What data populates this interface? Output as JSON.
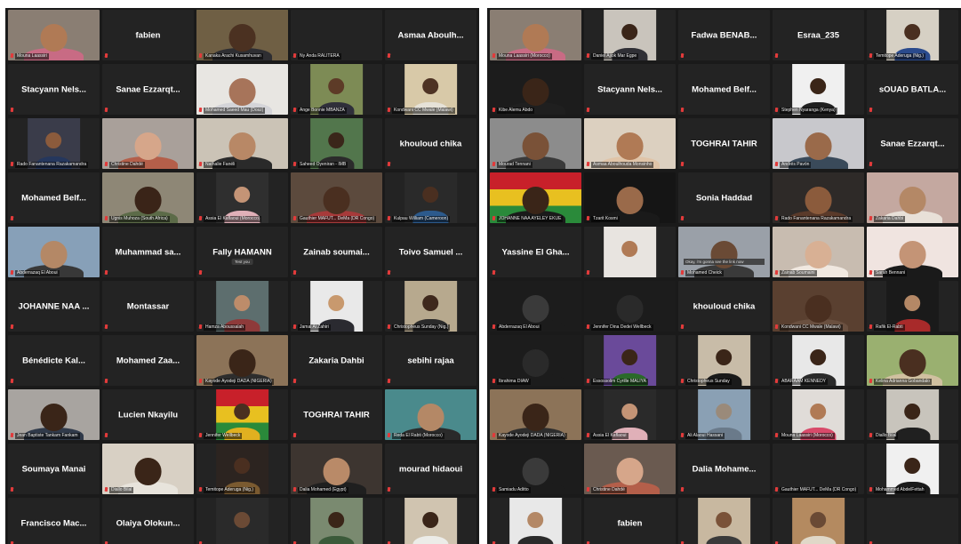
{
  "left_tiles": [
    {
      "kind": "video",
      "label": "Mouna Laassiri",
      "bg": "#8a7e73",
      "skin": "#b07a55",
      "shirt": "#c86b84",
      "wide": true
    },
    {
      "kind": "name",
      "label": "fabien"
    },
    {
      "kind": "video",
      "label": "Kanaka Arachi Kusamhuvan",
      "bg": "#6f5f44",
      "skin": "#4b3121",
      "shirt": "#2e2e32",
      "wide": true,
      "active": true
    },
    {
      "kind": "name",
      "label": "",
      "sub": "Ny Anda RALITERA"
    },
    {
      "kind": "name",
      "label": "Asmaa Aboulh..."
    },
    {
      "kind": "name",
      "label": "Stacyann Nels..."
    },
    {
      "kind": "name",
      "label": "Sanae Ezzarqt..."
    },
    {
      "kind": "video",
      "label": "Mohamed Saeed Mau (Dosz)",
      "bg": "#e8e6e2",
      "skin": "#a7745a",
      "shirt": "#d4d4d8",
      "wide": true
    },
    {
      "kind": "video",
      "label": "Ange Bonnie MBANZA",
      "bg": "#7d8b55",
      "skin": "#5d3b27",
      "shirt": "#2f2f3a",
      "wide": false
    },
    {
      "kind": "video",
      "label": "Kondwani CC Mwale (Malawi)",
      "bg": "#d8c9a8",
      "skin": "#4e3324",
      "shirt": "#e6e2d8",
      "wide": false
    },
    {
      "kind": "video",
      "label": "Rado Fanantenana Razakamandra",
      "bg": "#3a3c4a",
      "skin": "#8b5b3c",
      "shirt": "#25375d",
      "wide": false
    },
    {
      "kind": "video",
      "label": "Christine Dahdé",
      "bg": "#a9a09a",
      "skin": "#d6a68a",
      "shirt": "#b45f4a",
      "wide": true
    },
    {
      "kind": "video",
      "label": "Nathalie Fanéli",
      "bg": "#cbc3b6",
      "skin": "#b88866",
      "shirt": "#2a2a2a",
      "wide": true
    },
    {
      "kind": "video",
      "label": "Saheed Oyeniran - IMB",
      "bg": "#52764c",
      "skin": "#3a261a",
      "shirt": "#2b2b2b",
      "wide": false
    },
    {
      "kind": "name",
      "label": "khouloud chika"
    },
    {
      "kind": "name",
      "label": "Mohamed Belf..."
    },
    {
      "kind": "video",
      "label": "Ugnis Muhoza (South Africa)",
      "bg": "#8e8776",
      "skin": "#3a2418",
      "shirt": "#5c6b48",
      "wide": true
    },
    {
      "kind": "video",
      "label": "Assia El Kaflaoui (Morocco)",
      "bg": "#2f2f2f",
      "skin": "#c49476",
      "shirt": "#e0b0b8",
      "wide": false
    },
    {
      "kind": "video",
      "label": "Gauthier MAFUT... DeMa (DR Congo)",
      "bg": "#5c4a3d",
      "skin": "#4a2f20",
      "shirt": "#a73a3a",
      "wide": true
    },
    {
      "kind": "video",
      "label": "Kulpau William (Cameroon)",
      "bg": "#2a2a2a",
      "skin": "#4a2f20",
      "shirt": "#2c5a8c",
      "wide": false
    },
    {
      "kind": "video",
      "label": "Abderrazaq El Aboui",
      "bg": "#87a0b8",
      "skin": "#b48866",
      "shirt": "#383838",
      "wide": true
    },
    {
      "kind": "name",
      "label": "Muhammad sa..."
    },
    {
      "kind": "name",
      "label": "Fally HAMANN",
      "pill": "Test you"
    },
    {
      "kind": "name",
      "label": "Zainab soumai..."
    },
    {
      "kind": "name",
      "label": "Toivo Samuel ..."
    },
    {
      "kind": "name",
      "label": "JOHANNE NAA ..."
    },
    {
      "kind": "name",
      "label": "Montassar"
    },
    {
      "kind": "video",
      "label": "Hamza Aboussalah",
      "bg": "#5d6e6e",
      "skin": "#bd8c6a",
      "shirt": "#8e3a3a",
      "wide": false
    },
    {
      "kind": "video",
      "label": "Jamal Al Zahiri",
      "bg": "#e9e9e9",
      "skin": "#c8996e",
      "shirt": "#2a2a30",
      "wide": false
    },
    {
      "kind": "video",
      "label": "Christopheus Sunday (Nig.)",
      "bg": "#b7a98e",
      "skin": "#3e281c",
      "shirt": "#2a2a2a",
      "wide": false
    },
    {
      "kind": "name",
      "label": "Bénédicte Kal..."
    },
    {
      "kind": "name",
      "label": "Mohamed Zaa..."
    },
    {
      "kind": "video",
      "label": "Kayode Ayodeji DADA (NIGERIA)",
      "bg": "#8c7358",
      "skin": "#3a2518",
      "shirt": "#2d2d2d",
      "wide": true
    },
    {
      "kind": "name",
      "label": "Zakaria Dahbi"
    },
    {
      "kind": "name",
      "label": "sebihi rajaa"
    },
    {
      "kind": "video",
      "label": "Jean Baptiste Tankam Fankam",
      "bg": "#a8a4a0",
      "skin": "#3a2518",
      "shirt": "#303a4a",
      "wide": true
    },
    {
      "kind": "name",
      "label": "Lucien Nkayilu"
    },
    {
      "kind": "video",
      "label": "Jennifer Wellbeck",
      "bg": "#3c8a3a",
      "skin": "#4a2f20",
      "shirt": "#e0b020",
      "wide": false,
      "flag": true
    },
    {
      "kind": "name",
      "label": "TOGHRAI TAHIR"
    },
    {
      "kind": "video",
      "label": "Reda El Rabti (Morocco)",
      "bg": "#4a8a8c",
      "skin": "#b48866",
      "shirt": "#2a2a2a",
      "wide": true
    },
    {
      "kind": "name",
      "label": "Soumaya Manai"
    },
    {
      "kind": "video",
      "label": "Diallo Bilal",
      "bg": "#d8d0c4",
      "skin": "#3a2518",
      "shirt": "#e8e4dc",
      "wide": true
    },
    {
      "kind": "video",
      "label": "Temitope Aderuga (Nig.)",
      "bg": "#2c2420",
      "skin": "#4a2f20",
      "shirt": "#7a5a30",
      "wide": false
    },
    {
      "kind": "video",
      "label": "Dalia Mohamed (Egypt)",
      "bg": "#3d3530",
      "skin": "#b98a68",
      "shirt": "#1f1f1f",
      "wide": true
    },
    {
      "kind": "name",
      "label": "mourad hidaoui"
    },
    {
      "kind": "name",
      "label": "Francisco Mac..."
    },
    {
      "kind": "name",
      "label": "Olaiya Olokun..."
    },
    {
      "kind": "video",
      "label": "",
      "bg": "#2a2a2a",
      "skin": "#6b4a35",
      "shirt": "#2a2a2a",
      "wide": false
    },
    {
      "kind": "video",
      "label": "",
      "bg": "#7a8a70",
      "skin": "#3a2518",
      "shirt": "#3b5a3a",
      "wide": false
    },
    {
      "kind": "video",
      "label": "",
      "bg": "#d0c4b0",
      "skin": "#3a2518",
      "shirt": "#ecece8",
      "wide": false
    }
  ],
  "right_tiles": [
    {
      "kind": "video",
      "label": "Mouna Laassiri (Morocco)",
      "bg": "#8a7e73",
      "skin": "#b07a55",
      "shirt": "#c86b84",
      "wide": true
    },
    {
      "kind": "video",
      "label": "Daniel Ajiok Mar Egpe",
      "bg": "#c9c4bc",
      "skin": "#3a2518",
      "shirt": "#2f2f35",
      "wide": false
    },
    {
      "kind": "name",
      "label": "Fadwa BENAB..."
    },
    {
      "kind": "name",
      "label": "Esraa_235"
    },
    {
      "kind": "video",
      "label": "Temitope Aderuga (Nig.)",
      "bg": "#d6d0c4",
      "skin": "#4a2f20",
      "shirt": "#2a4a8c",
      "wide": false
    },
    {
      "kind": "video",
      "label": "Kibe Alemu Abdo",
      "bg": "#1c1c1c",
      "skin": "#3a2518",
      "shirt": "#1f1f1f",
      "wide": true
    },
    {
      "kind": "name",
      "label": "Stacyann Nels..."
    },
    {
      "kind": "name",
      "label": "Mohamed Belf..."
    },
    {
      "kind": "video",
      "label": "Stephen Nyaranga (Kenya)",
      "bg": "#f0f0f0",
      "skin": "#3a2518",
      "shirt": "#202020",
      "wide": false
    },
    {
      "kind": "name",
      "label": "sOUAD BATLA..."
    },
    {
      "kind": "video",
      "label": "Mourad Tennani",
      "bg": "#8c8c8c",
      "skin": "#7a5238",
      "shirt": "#3a3a3a",
      "wide": true
    },
    {
      "kind": "video",
      "label": "Asmaa Aboulhouda Monsinho",
      "bg": "#dcd0c0",
      "skin": "#b07a55",
      "shirt": "#e0c4a8",
      "wide": true
    },
    {
      "kind": "name",
      "label": "TOGHRAI TAHIR"
    },
    {
      "kind": "video",
      "label": "Andrés Pavón",
      "bg": "#c8c8cc",
      "skin": "#9a6a4a",
      "shirt": "#3a4a5a",
      "wide": true
    },
    {
      "kind": "name",
      "label": "Sanae Ezzarqt..."
    },
    {
      "kind": "video",
      "label": "JOHANNE NAA AYELEY EKUE",
      "bg": "#2a8a3a",
      "skin": "#3a2518",
      "shirt": "#1a1a1a",
      "wide": true,
      "flag": true
    },
    {
      "kind": "video",
      "label": "Tzarit Kosmi",
      "bg": "#151515",
      "skin": "#9a6a4a",
      "shirt": "#1a1a1a",
      "wide": true
    },
    {
      "kind": "name",
      "label": "Sonia Haddad"
    },
    {
      "kind": "video",
      "label": "Rado Fanantenana Razakamandra",
      "bg": "#2e2a28",
      "skin": "#8b5b3c",
      "shirt": "#5a3a2a",
      "wide": true
    },
    {
      "kind": "video",
      "label": "Zakaria Dahbi",
      "bg": "#c4a8a0",
      "skin": "#b48866",
      "shirt": "#e8e0d8",
      "wide": true
    },
    {
      "kind": "name",
      "label": "Yassine El Gha..."
    },
    {
      "kind": "video",
      "label": "",
      "bg": "#e8e4e0",
      "skin": "#b07a55",
      "shirt": "#e8e4e0",
      "wide": false
    },
    {
      "kind": "video",
      "label": "Mohamed Cheick",
      "bg": "#9aa0a8",
      "skin": "#6a4a35",
      "shirt": "#3a3a3a",
      "wide": true,
      "bubble": "Okay, i'm gonna see the link now"
    },
    {
      "kind": "video",
      "label": "Zainab Soumaini",
      "bg": "#c8bcb0",
      "skin": "#d8b094",
      "shirt": "#f0e8e0",
      "wide": true
    },
    {
      "kind": "video",
      "label": "Sarah Bennani",
      "bg": "#f0e4e0",
      "skin": "#c49476",
      "shirt": "#1a1a1a",
      "wide": true
    },
    {
      "kind": "video",
      "label": "Abderrazaq El Aboui",
      "bg": "#1c1c1c",
      "skin": "#3a3a3a",
      "shirt": "#1c1c1c",
      "wide": true
    },
    {
      "kind": "video",
      "label": "Jennifer Dina Dedei Wellbeck",
      "bg": "#1c1c1c",
      "skin": "#2a2a2a",
      "shirt": "#1c1c1c",
      "wide": true
    },
    {
      "kind": "name",
      "label": "khouloud chika"
    },
    {
      "kind": "video",
      "label": "Kondwani CC Mwale (Malawi)",
      "bg": "#5a4030",
      "skin": "#4a2f20",
      "shirt": "#6a5040",
      "wide": true
    },
    {
      "kind": "video",
      "label": "Rafik El-Rabti",
      "bg": "#1a1a1a",
      "skin": "#b48866",
      "shirt": "#a82a2a",
      "wide": false
    },
    {
      "kind": "video",
      "label": "Ibrahima DIAW",
      "bg": "#1c1c1c",
      "skin": "#2a2a2a",
      "shirt": "#1c1c1c",
      "wide": true
    },
    {
      "kind": "video",
      "label": "Essossolim Cyrille MALIYA",
      "bg": "#6a4a9a",
      "skin": "#3a2518",
      "shirt": "#2a6a2a",
      "wide": false
    },
    {
      "kind": "video",
      "label": "Christopheus Sunday",
      "bg": "#c8bca8",
      "skin": "#3a2518",
      "shirt": "#1a1a1a",
      "wide": false
    },
    {
      "kind": "video",
      "label": "ABARAAM KENNEDY",
      "bg": "#e8e8e8",
      "skin": "#3a2518",
      "shirt": "#2a2a2a",
      "wide": false
    },
    {
      "kind": "video",
      "label": "Kelina Adrianna Gobandalo",
      "bg": "#9ab070",
      "skin": "#4a2f20",
      "shirt": "#d0c0a0",
      "wide": true
    },
    {
      "kind": "video",
      "label": "Kayode Ayodeji DADA (NIGERIA)",
      "bg": "#8c7358",
      "skin": "#3a2518",
      "shirt": "#2d2d2d",
      "wide": true
    },
    {
      "kind": "video",
      "label": "Assia El Kaflaoui",
      "bg": "#2a2a2a",
      "skin": "#c49476",
      "shirt": "#e0b0b8",
      "wide": false
    },
    {
      "kind": "video",
      "label": "Ali Alaoui Hassani",
      "bg": "#8aa0b4",
      "skin": "#9a8a7a",
      "shirt": "#6a7a8a",
      "wide": false
    },
    {
      "kind": "video",
      "label": "Mouna Laassiri (Morocco)",
      "bg": "#e0dcd8",
      "skin": "#b07a55",
      "shirt": "#d84a6a",
      "wide": false
    },
    {
      "kind": "video",
      "label": "Diallo Bilal",
      "bg": "#c8c4bc",
      "skin": "#3a2518",
      "shirt": "#202020",
      "wide": false
    },
    {
      "kind": "video",
      "label": "Samiadu Aditto",
      "bg": "#1c1c1c",
      "skin": "#3a3a3a",
      "shirt": "#1c1c1c",
      "wide": true
    },
    {
      "kind": "video",
      "label": "Christine Dahdé",
      "bg": "#6a5a50",
      "skin": "#d6a68a",
      "shirt": "#b45f4a",
      "wide": true
    },
    {
      "kind": "name",
      "label": "Dalia Mohame..."
    },
    {
      "kind": "name",
      "label": "",
      "sub": "Gauthier MAFUT... DeMa (DR Congo)"
    },
    {
      "kind": "video",
      "label": "Mohammed AbdelFettah",
      "bg": "#f0f0f0",
      "skin": "#3a2518",
      "shirt": "#1a1a1a",
      "wide": false
    },
    {
      "kind": "video",
      "label": "",
      "bg": "#e8e8e8",
      "skin": "#b48866",
      "shirt": "#2a2a2a",
      "wide": false
    },
    {
      "kind": "name",
      "label": "fabien"
    },
    {
      "kind": "video",
      "label": "",
      "bg": "#c8b8a0",
      "skin": "#7a5238",
      "shirt": "#3a3a3a",
      "wide": false
    },
    {
      "kind": "video",
      "label": "",
      "bg": "#b48a60",
      "skin": "#6a4a35",
      "shirt": "#e0d8c8",
      "wide": false
    },
    {
      "kind": "name",
      "label": ""
    }
  ]
}
